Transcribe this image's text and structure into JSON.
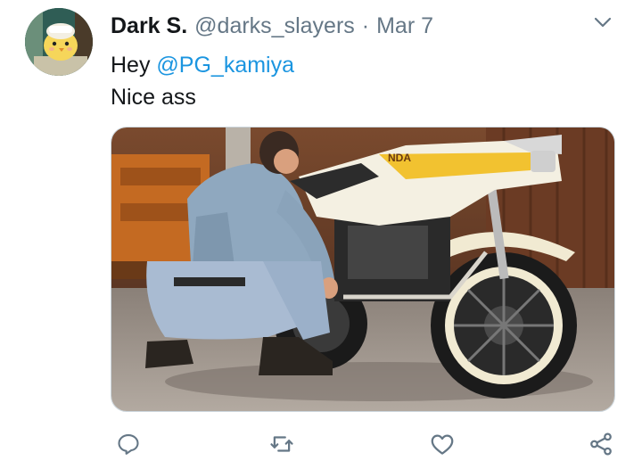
{
  "tweet": {
    "author": {
      "display_name": "Dark S.",
      "handle": "@darks_slayers",
      "avatar_icon": "yellow-chick-avatar"
    },
    "separator": "·",
    "date": "Mar 7",
    "text": {
      "greeting": "Hey",
      "mention": "@PG_kamiya",
      "line2": "Nice ass"
    },
    "media": {
      "description_icon": "motorcycle-photo",
      "bike_brand_text": "NDA"
    },
    "actions": {
      "reply_icon": "reply-icon",
      "retweet_icon": "retweet-icon",
      "like_icon": "heart-icon",
      "share_icon": "share-icon"
    },
    "colors": {
      "text_primary": "#14171a",
      "text_secondary": "#657786",
      "link": "#1b95e0",
      "border": "#ccd6dd"
    }
  }
}
